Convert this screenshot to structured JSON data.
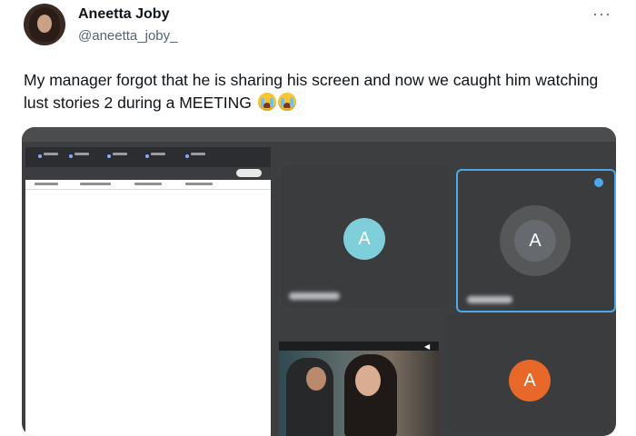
{
  "tweet": {
    "display_name": "Aneetta Joby",
    "handle": "@aneetta_joby_",
    "more_label": "···",
    "text": "My manager forgot that he is sharing his screen and now we caught him watching lust stories 2 during a MEETING",
    "emoji_icons": [
      "loudly-crying-face-icon",
      "loudly-crying-face-icon"
    ]
  },
  "meeting": {
    "participants": [
      {
        "initial": "A",
        "color": "#7fcfda"
      },
      {
        "initial": "A",
        "color": "#666a6e",
        "speaking": true
      },
      {
        "initial": "A",
        "color": "#e8682a"
      }
    ]
  },
  "colors": {
    "handle_gray": "#536471",
    "active_border": "#4ca8e8"
  }
}
